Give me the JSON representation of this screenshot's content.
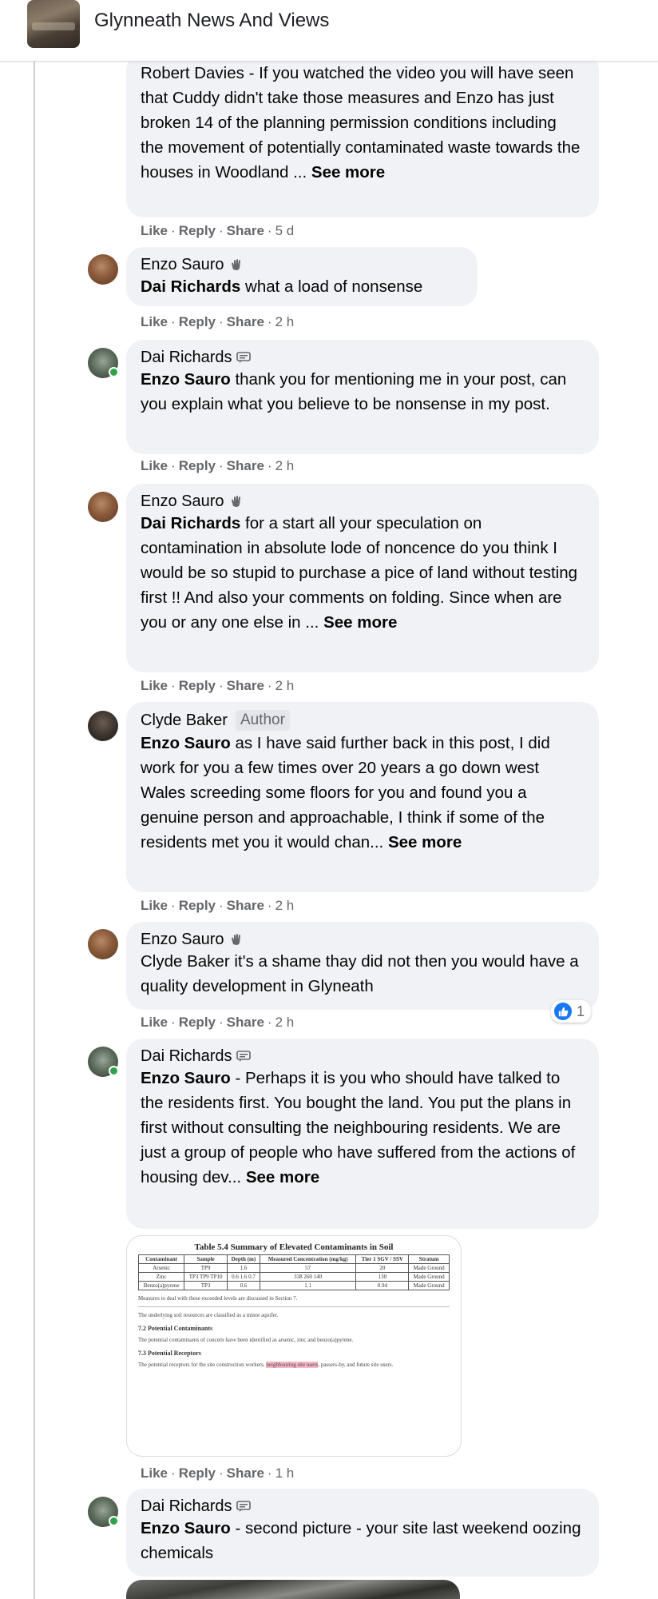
{
  "header": {
    "group_name": "Glynneath News And Views"
  },
  "actions": {
    "like": "Like",
    "reply": "Reply",
    "share": "Share",
    "sep": "·"
  },
  "comments": [
    {
      "author": "",
      "text": "Robert Davies - If you watched the video you will have seen that Cuddy didn't take those measures and Enzo has just broken 14 of the planning permission conditions including the movement of potentially contaminated waste towards the houses in Woodland ...",
      "see_more": "See more",
      "time": "5 d"
    },
    {
      "author": "Enzo Sauro",
      "mention": "Dai Richards",
      "text": " what a load of nonsense",
      "time": "2 h"
    },
    {
      "author": "Dai Richards",
      "mention": "Enzo Sauro",
      "text": " thank you for mentioning me in your post, can you explain what you believe to be nonsense in my post.",
      "time": "2 h"
    },
    {
      "author": "Enzo Sauro",
      "mention": "Dai Richards",
      "text": " for a start all your speculation on contamination in absolute lode of noncence do you think I would be so stupid to purchase a pice of land without testing first !! And also your comments on folding. Since when are you or any one else in ...",
      "see_more": "See more",
      "time": "2 h"
    },
    {
      "author": "Clyde Baker",
      "author_tag": "Author",
      "mention": "Enzo Sauro",
      "text": " as I have said further back in this post, I did work for you a few times over 20 years a go down west Wales screeding some floors for you and found you a genuine person and approachable, I think if some of the residents met you it would chan...",
      "see_more": "See more",
      "time": "2 h"
    },
    {
      "author": "Enzo Sauro",
      "mention": "",
      "text": "Clyde Baker it's a shame thay did not then you would have a quality development in Glyneath",
      "time": "2 h",
      "reaction_count": "1"
    },
    {
      "author": "Dai Richards",
      "mention": "Enzo Sauro",
      "text": " - Perhaps it is you who should have talked to the residents first. You bought the land. You put the plans in first without consulting the neighbouring residents. We are just a group of people who have suffered from the actions of housing dev...",
      "see_more": "See more",
      "time": "1 h"
    },
    {
      "author": "Dai Richards",
      "mention": "Enzo Sauro",
      "text": " - second picture - your site last weekend oozing chemicals"
    }
  ],
  "attachment": {
    "table_title": "Table 5.4    Summary of Elevated Contaminants in Soil",
    "headers": [
      "Contaminant",
      "Sample",
      "Depth (m)",
      "Measured Concentration (mg/kg)",
      "Tier 1 SGV / SSV",
      "Stratum"
    ],
    "rows": [
      [
        "Arsenic",
        "TP9",
        "1.6",
        "57",
        "20",
        "Made Ground"
      ],
      [
        "Zinc",
        "TP3 TP9 TP10",
        "0.6 1.6 0.7",
        "338 260 140",
        "130",
        "Made Ground"
      ],
      [
        "Benzo(a)pyrene",
        "TP3",
        "0.6",
        "1.1",
        "0.94",
        "Made Ground"
      ]
    ],
    "note": "Measures to deal with these exceeded levels are discussed in Section 7.",
    "line2": "The underlying soil resources are classified as a minor aquifer.",
    "h1": "7.2    Potential Contaminants",
    "p1": "The potential contaminants of concern have been identified as arsenic, zinc and benzo(a)pyrene.",
    "h2": "7.3    Potential Receptors",
    "p2_a": "The potential receptors for the site construction workers, ",
    "p2_hl": "neighbouring site users",
    "p2_b": ", passers-by, and future site users."
  }
}
